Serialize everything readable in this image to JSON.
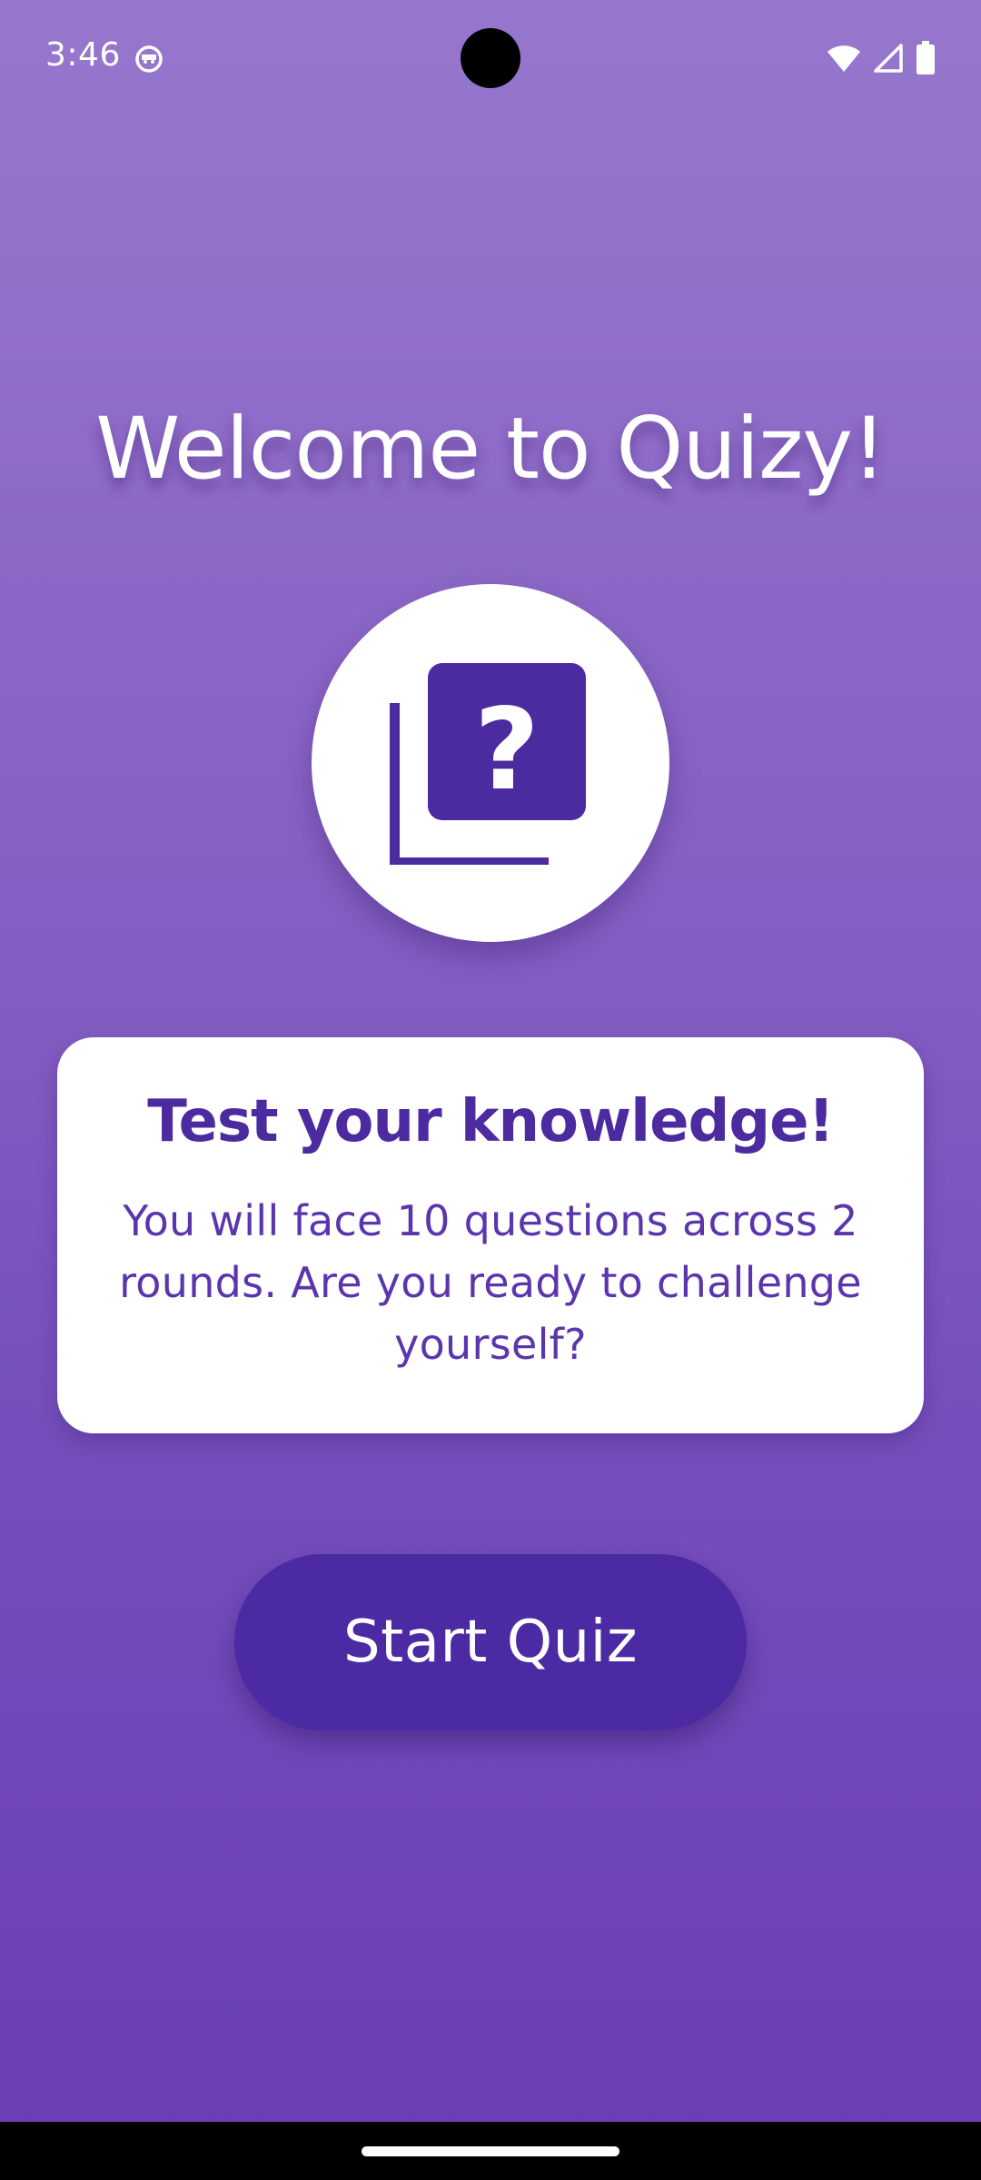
{
  "status_bar": {
    "time": "3:46",
    "icons": [
      "app-notification-icon",
      "wifi-icon",
      "cell-signal-icon",
      "battery-icon"
    ]
  },
  "welcome": {
    "title": "Welcome to Quizy!"
  },
  "logo": {
    "icon": "quiz-question-icon",
    "symbol": "?"
  },
  "card": {
    "title": "Test your knowledge!",
    "text": "You will face 10 questions across 2 rounds. Are you ready to challenge yourself?"
  },
  "start_button": {
    "label": "Start Quiz"
  },
  "colors": {
    "background_top": "#9677cd",
    "background_bottom": "#6a3db5",
    "accent": "#4c2aa0",
    "card": "#ffffff",
    "text_on_dark": "#ffffff"
  }
}
